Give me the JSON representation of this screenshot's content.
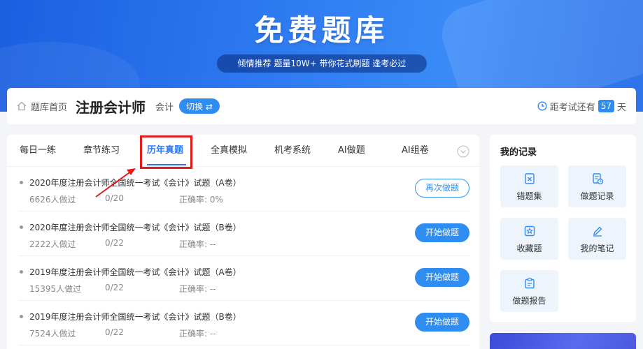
{
  "banner": {
    "title": "免费题库",
    "subtitle": "倾情推荐 题量10W+ 带你花式刷题 逢考必过"
  },
  "topbar": {
    "breadcrumb": "题库首页",
    "exam_title": "注册会计师",
    "subject": "会计",
    "switch_label": "切换 ⇄",
    "countdown_prefix": "距考试还有",
    "countdown_days": "57",
    "countdown_unit": "天"
  },
  "tabs": [
    {
      "label": "每日一练"
    },
    {
      "label": "章节练习"
    },
    {
      "label": "历年真题"
    },
    {
      "label": "全真模拟"
    },
    {
      "label": "机考系统"
    },
    {
      "label": "AI做题"
    },
    {
      "label": "AI组卷"
    }
  ],
  "active_tab": "历年真题",
  "papers": [
    {
      "title": "2020年度注册会计师全国统一考试《会计》试题（A卷）",
      "takers": "6626人做过",
      "progress": "0/20",
      "accuracy": "正确率: 0%",
      "action": "再次做题"
    },
    {
      "title": "2020年度注册会计师全国统一考试《会计》试题（B卷）",
      "takers": "2222人做过",
      "progress": "0/22",
      "accuracy": "正确率: --",
      "action": "开始做题"
    },
    {
      "title": "2019年度注册会计师全国统一考试《会计》试题（A卷）",
      "takers": "15395人做过",
      "progress": "0/22",
      "accuracy": "正确率: --",
      "action": "开始做题"
    },
    {
      "title": "2019年度注册会计师全国统一考试《会计》试题（B卷）",
      "takers": "7524人做过",
      "progress": "0/22",
      "accuracy": "正确率: --",
      "action": "开始做题"
    }
  ],
  "records": {
    "title": "我的记录",
    "items": [
      {
        "label": "错题集",
        "icon": "wrong-book-icon"
      },
      {
        "label": "做题记录",
        "icon": "history-icon"
      },
      {
        "label": "收藏题",
        "icon": "star-icon"
      },
      {
        "label": "我的笔记",
        "icon": "pencil-icon"
      },
      {
        "label": "做题报告",
        "icon": "report-icon"
      }
    ]
  },
  "colors": {
    "accent": "#2f8cf0",
    "highlight": "#e31b1b",
    "banner": "#2f7cf2"
  }
}
